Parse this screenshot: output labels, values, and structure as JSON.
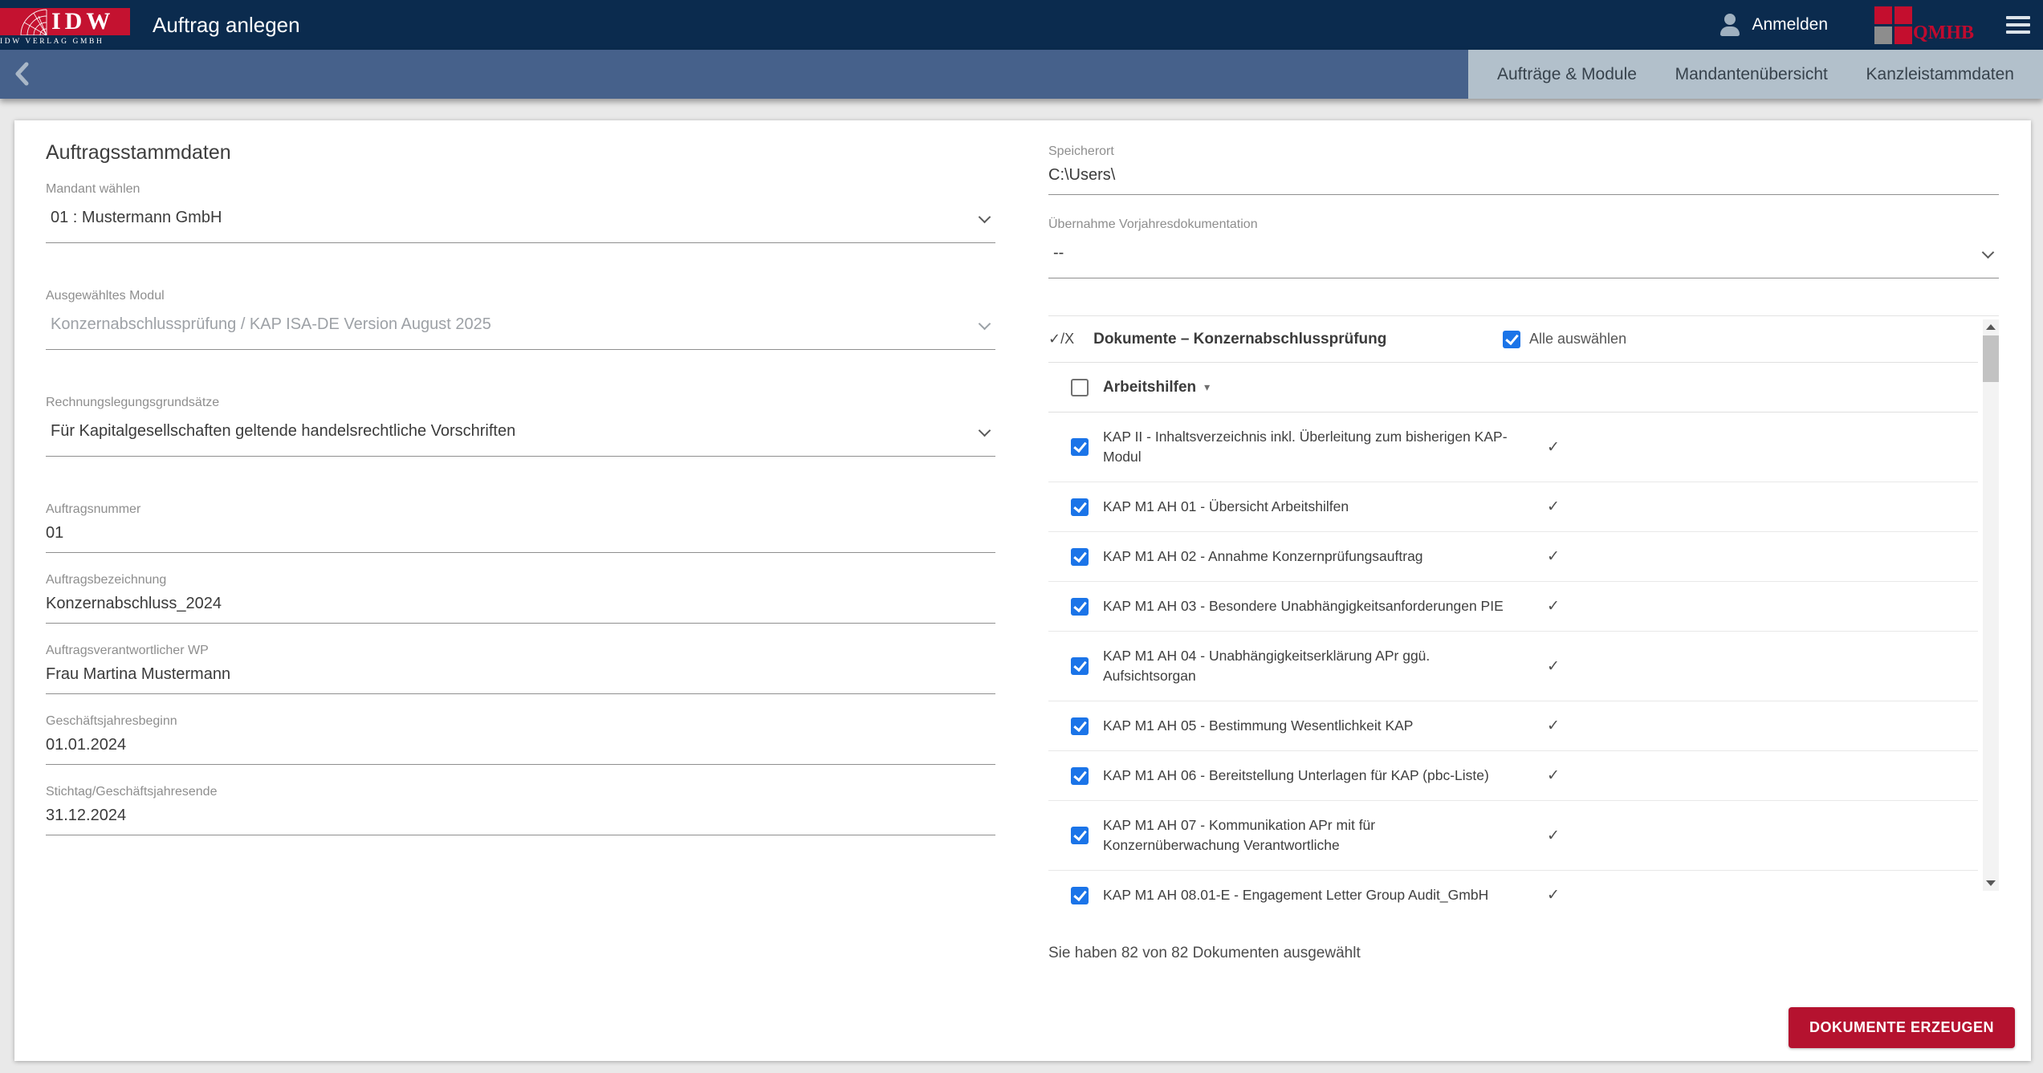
{
  "app": {
    "title": "Auftrag anlegen",
    "logo": {
      "word": "IDW",
      "sub": "IDW VERLAG GMBH"
    },
    "signin_label": "Anmelden",
    "qmhb_label": "QMHB"
  },
  "icons": {
    "person": "head-and-shoulders silhouette",
    "menu": "hamburger three bars",
    "back": "chevron-left",
    "select": "chevron-down",
    "sort_caret": "▾",
    "check": "✓"
  },
  "nav": {
    "tabs": [
      {
        "label": "Aufträge & Module"
      },
      {
        "label": "Mandantenübersicht"
      },
      {
        "label": "Kanzleistammdaten"
      }
    ]
  },
  "form": {
    "heading": "Auftragsstammdaten",
    "mandant": {
      "label": "Mandant wählen",
      "value": "01 : Mustermann GmbH"
    },
    "modul": {
      "label": "Ausgewähltes Modul",
      "value": "Konzernabschlussprüfung / KAP ISA-DE Version August 2025",
      "disabled": true
    },
    "rechnungslegung": {
      "label": "Rechnungslegungsgrundsätze",
      "value": "Für Kapitalgesellschaften geltende handelsrechtliche Vorschriften"
    },
    "auftragsnummer": {
      "label": "Auftragsnummer",
      "value": "01"
    },
    "auftragsbezeichnung": {
      "label": "Auftragsbezeichnung",
      "value": "Konzernabschluss_2024"
    },
    "verantwortlicher": {
      "label": "Auftragsverantwortlicher WP",
      "value": "Frau Martina Mustermann"
    },
    "beginn": {
      "label": "Geschäftsjahresbeginn",
      "value": "01.01.2024"
    },
    "ende": {
      "label": "Stichtag/Geschäftsjahresende",
      "value": "31.12.2024"
    }
  },
  "storage": {
    "speicherort": {
      "label": "Speicherort",
      "value": "C:\\Users\\"
    },
    "vorjahr": {
      "label": "Übernahme Vorjahresdokumentation",
      "value": "--"
    }
  },
  "documents": {
    "header_prefix": "✓/X",
    "header_title": "Dokumente – Konzernabschlussprüfung",
    "select_all_label": "Alle auswählen",
    "select_all_checked": true,
    "group": {
      "label": "Arbeitshilfen",
      "checked": false,
      "sort_icon": "▾"
    },
    "items": [
      {
        "label": "KAP II - Inhaltsverzeichnis inkl. Überleitung zum bisherigen KAP-Modul",
        "checked": true,
        "status": "✓"
      },
      {
        "label": "KAP M1 AH 01 - Übersicht Arbeitshilfen",
        "checked": true,
        "status": "✓"
      },
      {
        "label": "KAP M1 AH 02 - Annahme Konzernprüfungsauftrag",
        "checked": true,
        "status": "✓"
      },
      {
        "label": "KAP M1 AH 03 - Besondere Unabhängigkeitsanforderungen PIE",
        "checked": true,
        "status": "✓"
      },
      {
        "label": "KAP M1 AH 04 - Unabhängigkeitserklärung APr ggü. Aufsichtsorgan",
        "checked": true,
        "status": "✓"
      },
      {
        "label": "KAP M1 AH 05 - Bestimmung Wesentlichkeit KAP",
        "checked": true,
        "status": "✓"
      },
      {
        "label": "KAP M1 AH 06 - Bereitstellung Unterlagen für KAP (pbc-Liste)",
        "checked": true,
        "status": "✓"
      },
      {
        "label": "KAP M1 AH 07 - Kommunikation APr mit für Konzernüberwachung Verantwortliche",
        "checked": true,
        "status": "✓"
      },
      {
        "label": "KAP M1 AH 08.01-E - Engagement Letter Group Audit_GmbH",
        "checked": true,
        "status": "✓"
      }
    ],
    "summary": "Sie haben 82 von 82 Dokumenten ausgewählt"
  },
  "actions": {
    "generate_label": "DOKUMENTE ERZEUGEN"
  },
  "colors": {
    "topbar": "#0b2b4e",
    "subbar": "#46618b",
    "tabs_bg": "#b2c0cb",
    "brand_red": "#c41230",
    "button_red": "#b5122f",
    "checkbox_blue": "#1b74e8",
    "page_bg": "#e9e9e9"
  }
}
